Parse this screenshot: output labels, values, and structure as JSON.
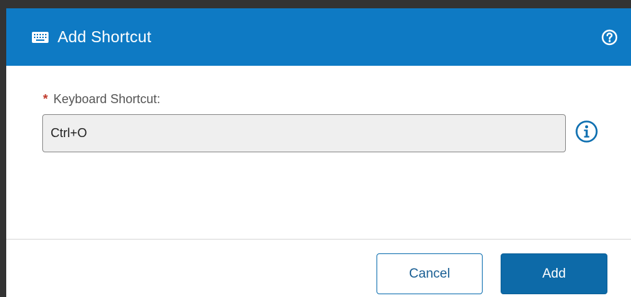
{
  "dialog": {
    "title": "Add Shortcut",
    "title_icon": "keyboard-icon",
    "help_icon": "help-circle-icon"
  },
  "form": {
    "required_marker": "*",
    "label": "Keyboard Shortcut:",
    "value": "Ctrl+O",
    "info_icon": "info-circle-icon"
  },
  "footer": {
    "cancel_label": "Cancel",
    "add_label": "Add"
  },
  "colors": {
    "header_bg": "#0e7ac4",
    "primary_button": "#0d6aa8",
    "required": "#c0392b"
  }
}
